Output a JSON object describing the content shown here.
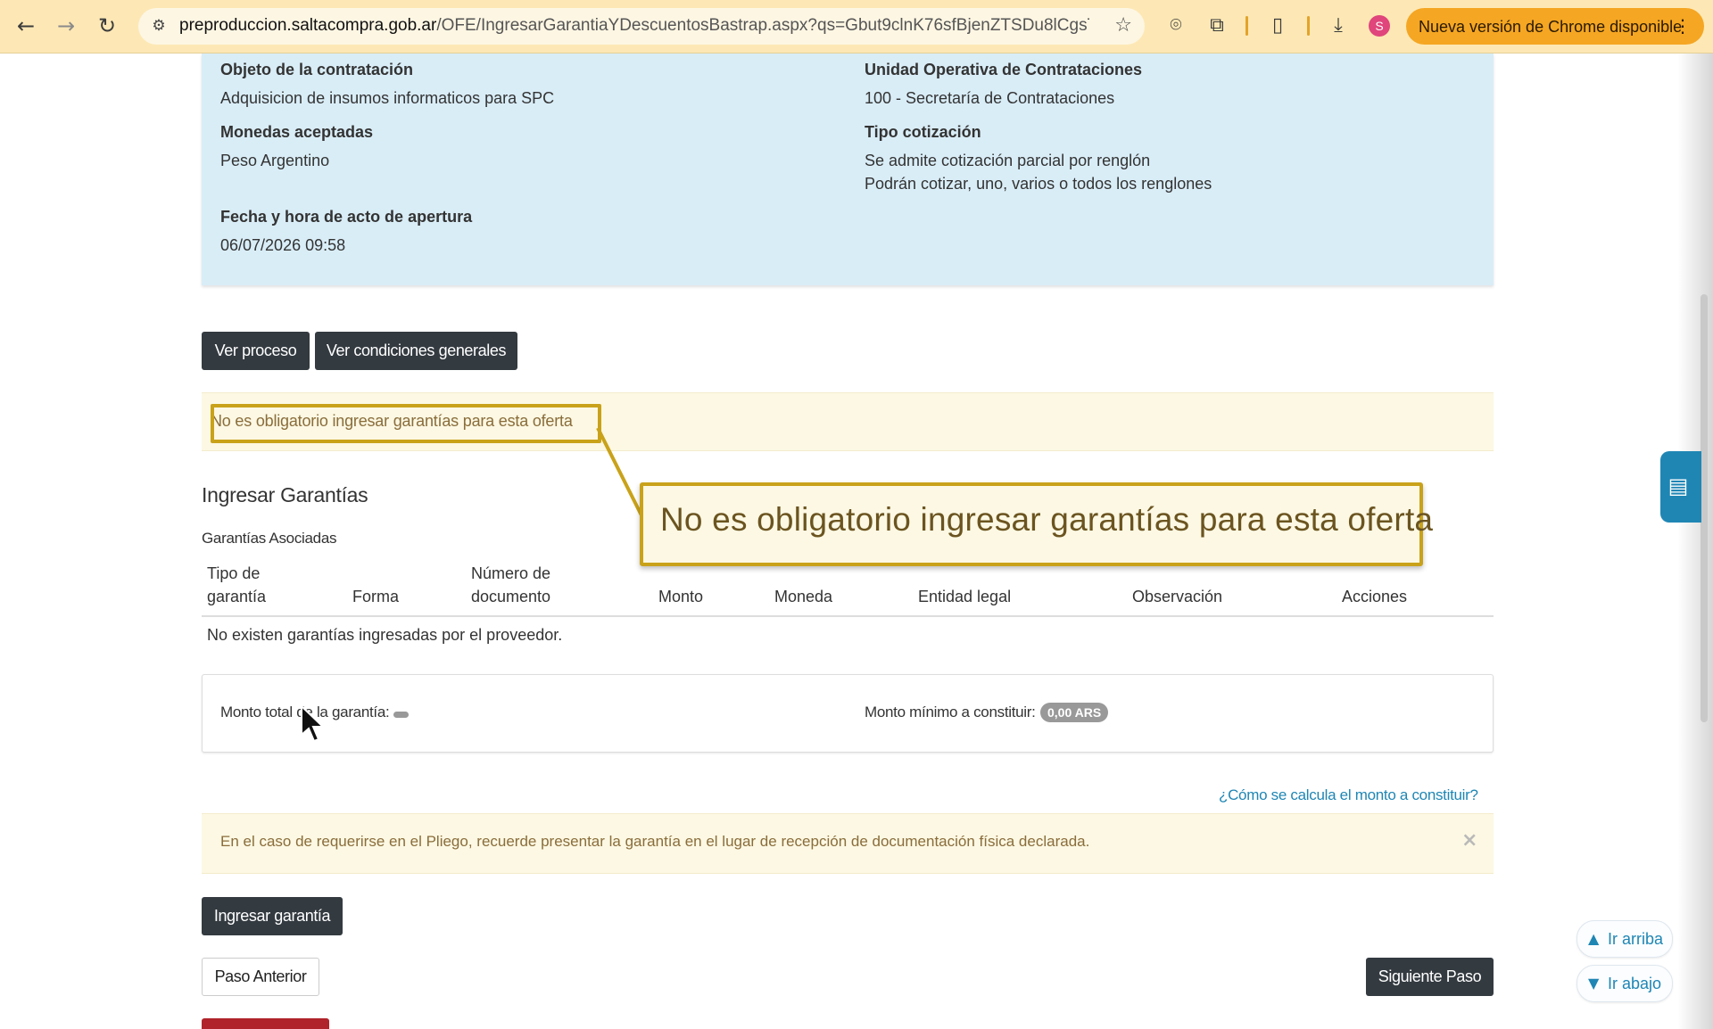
{
  "browser": {
    "url_host": "preproduccion.saltacompra.gob.ar",
    "url_path": "/OFE/IngresarGarantiaYDescuentosBastrap.aspx?qs=Gbut9clnK76sfBjenZTSDu8lCgsT...",
    "profile_initial": "S",
    "update_label": "Nueva versión de Chrome disponible",
    "icons": [
      "back-icon",
      "forward-icon",
      "reload-icon",
      "site-settings-icon",
      "star-icon",
      "camera-icon",
      "extensions-icon",
      "reading-list-icon",
      "download-icon",
      "more-icon"
    ]
  },
  "info": {
    "objeto_label": "Objeto de la contratación",
    "objeto_value": "Adquisicion de insumos informaticos para SPC",
    "unidad_label": "Unidad Operativa de Contrataciones",
    "unidad_value": "100 - Secretaría de Contrataciones",
    "monedas_label": "Monedas aceptadas",
    "monedas_value": "Peso Argentino",
    "tipo_label": "Tipo cotización",
    "tipo_value_1": "Se admite cotización parcial por renglón",
    "tipo_value_2": "Podrán cotizar, uno, varios o todos los renglones",
    "fecha_label": "Fecha y hora de acto de apertura",
    "fecha_value": "06/07/2026 09:58"
  },
  "actions": {
    "ver_proceso": "Ver proceso",
    "ver_condiciones": "Ver condiciones generales"
  },
  "warning": {
    "text": "No es obligatorio ingresar garantías para esta oferta",
    "callout": "No es obligatorio ingresar garantías para esta oferta"
  },
  "garantias": {
    "title": "Ingresar Garantías",
    "subtitle": "Garantías Asociadas",
    "columns": [
      {
        "l1": "Tipo de",
        "l2": "garantía"
      },
      {
        "l1": "",
        "l2": "Forma"
      },
      {
        "l1": "Número de",
        "l2": "documento"
      },
      {
        "l1": "",
        "l2": "Monto"
      },
      {
        "l1": "",
        "l2": "Moneda"
      },
      {
        "l1": "",
        "l2": "Entidad legal"
      },
      {
        "l1": "",
        "l2": "Observación"
      },
      {
        "l1": "",
        "l2": "Acciones"
      }
    ],
    "empty": "No existen garantías ingresadas por el proveedor."
  },
  "montos": {
    "total_label": "Monto total de la garantía:",
    "minimo_label": "Monto mínimo a constituir:",
    "minimo_value": "0,00 ARS"
  },
  "calc_link": "¿Cómo se calcula el monto a constituir?",
  "alert": {
    "text": "En el caso de requerirse en el Pliego, recuerde presentar la garantía en el lugar de recepción de documentación física declarada.",
    "close": "×"
  },
  "buttons": {
    "ingresar": "Ingresar garantía",
    "anterior": "Paso Anterior",
    "siguiente": "Siguiente Paso"
  },
  "floating": {
    "arriba": "Ir arriba",
    "abajo": "Ir abajo"
  },
  "colors": {
    "info_bg": "#d9edf7",
    "warning_bg": "#fcf8e3",
    "highlight_border": "#c9a21a",
    "dark_button": "#333a40",
    "link": "#1f86b4",
    "chrome_update": "#f5a623"
  }
}
